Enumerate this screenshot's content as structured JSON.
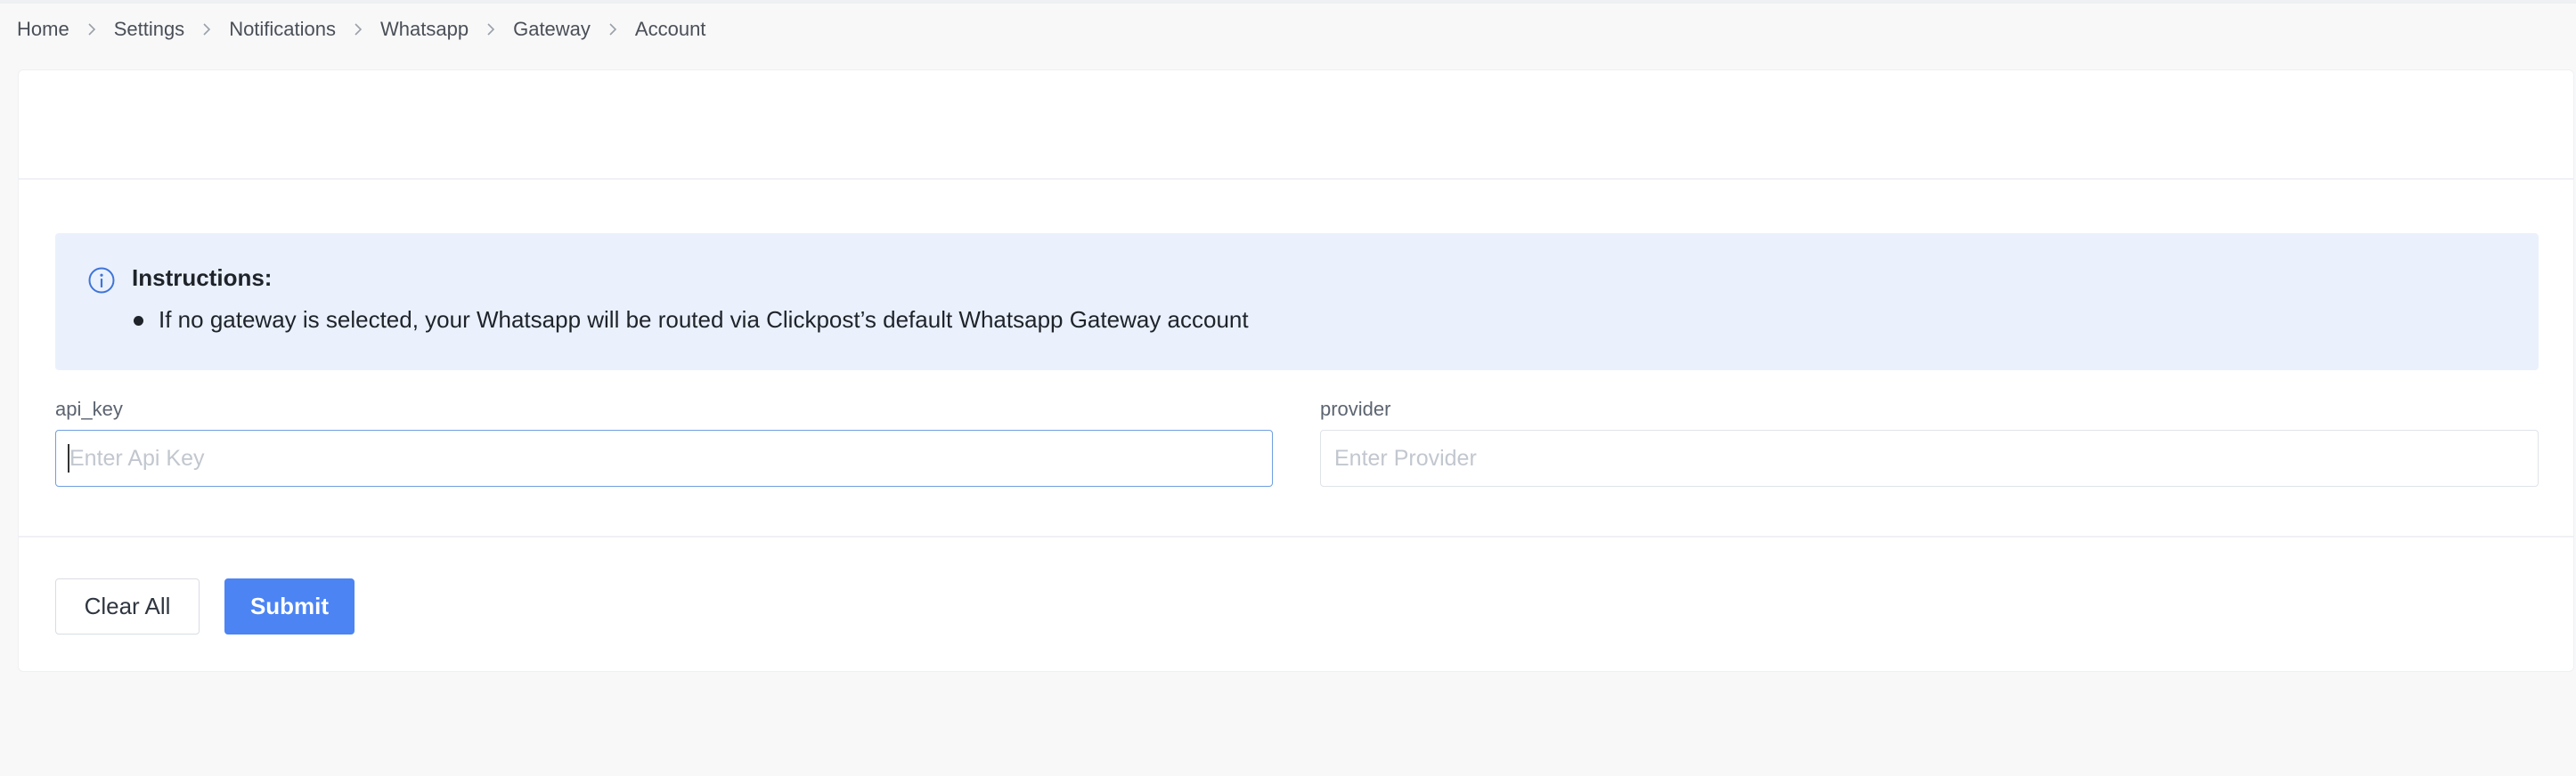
{
  "breadcrumb": {
    "items": [
      "Home",
      "Settings",
      "Notifications",
      "Whatsapp",
      "Gateway",
      "Account"
    ]
  },
  "instructions": {
    "icon": "info-icon",
    "title": "Instructions:",
    "items": [
      "If no gateway is selected, your Whatsapp will be routed via Clickpost’s default Whatsapp Gateway account"
    ]
  },
  "form": {
    "api_key": {
      "label": "api_key",
      "placeholder": "Enter Api Key",
      "value": ""
    },
    "provider": {
      "label": "provider",
      "placeholder": "Enter Provider",
      "value": ""
    }
  },
  "actions": {
    "clear_label": "Clear All",
    "submit_label": "Submit"
  },
  "colors": {
    "accent": "#4c84f3",
    "info_background": "#eaf1fd",
    "page_background": "#f8f8f9"
  }
}
